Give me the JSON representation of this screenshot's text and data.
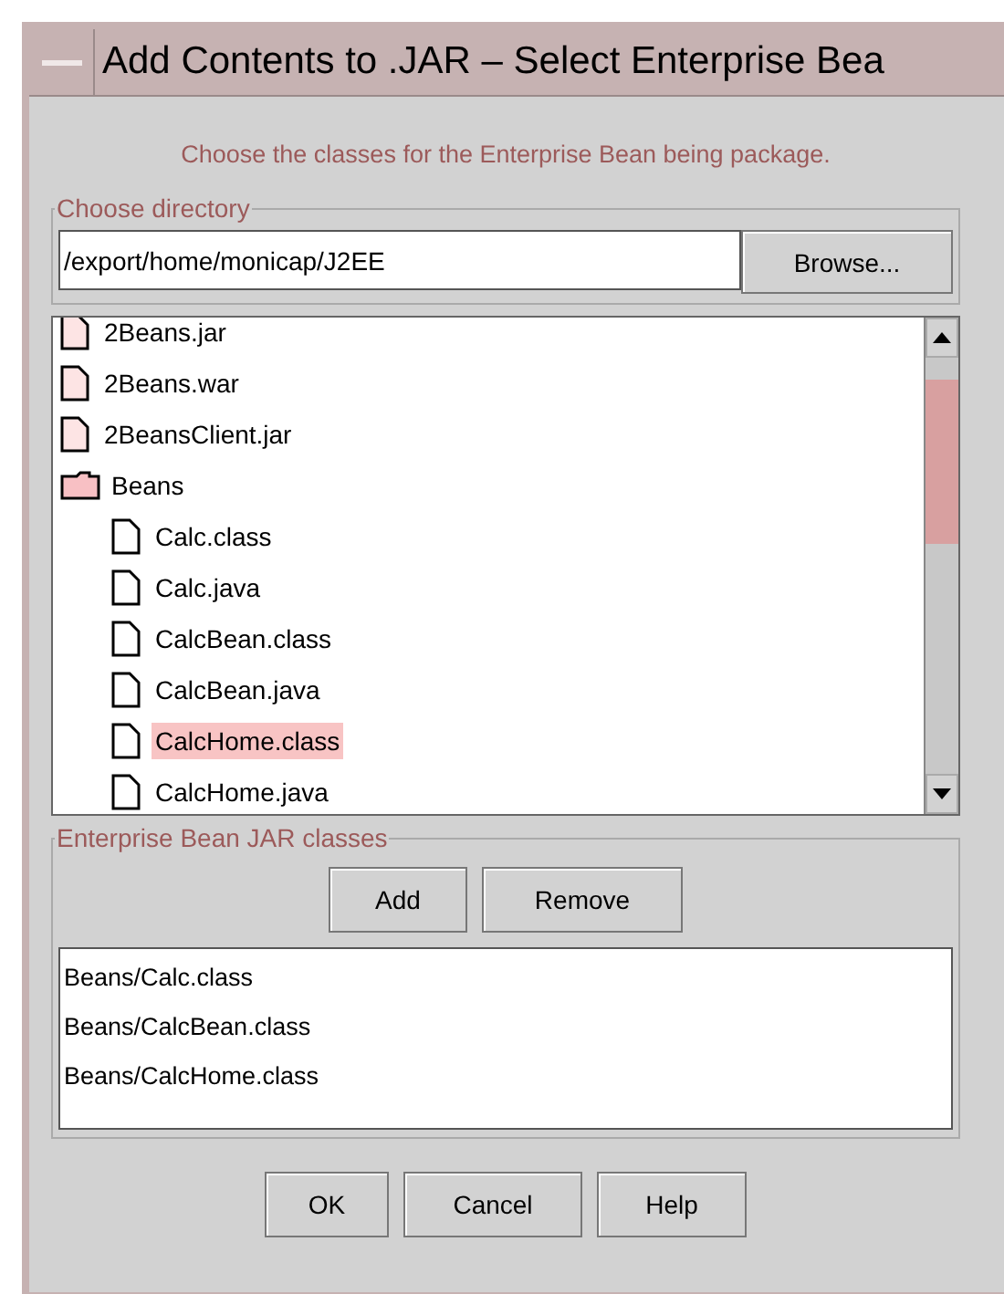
{
  "window": {
    "title": "Add Contents to .JAR – Select Enterprise Bea"
  },
  "instruction": "Choose the classes for the Enterprise Bean being package.",
  "directory": {
    "label": "Choose directory",
    "value": "/export/home/monicap/J2EE",
    "browse": "Browse..."
  },
  "tree": [
    {
      "name": "2Beans.jar",
      "kind": "file",
      "selected": false
    },
    {
      "name": "2Beans.war",
      "kind": "file",
      "selected": false
    },
    {
      "name": "2BeansClient.jar",
      "kind": "file",
      "selected": false
    },
    {
      "name": "Beans",
      "kind": "folder",
      "selected": false,
      "children": [
        {
          "name": "Calc.class",
          "kind": "file",
          "selected": false
        },
        {
          "name": "Calc.java",
          "kind": "file",
          "selected": false
        },
        {
          "name": "CalcBean.class",
          "kind": "file",
          "selected": false
        },
        {
          "name": "CalcBean.java",
          "kind": "file",
          "selected": false
        },
        {
          "name": "CalcHome.class",
          "kind": "file",
          "selected": true
        },
        {
          "name": "CalcHome.java",
          "kind": "file",
          "selected": false
        }
      ]
    }
  ],
  "jar_classes": {
    "label": "Enterprise Bean JAR classes",
    "buttons": [
      "Add",
      "Remove"
    ],
    "items": [
      "Beans/Calc.class",
      "Beans/CalcBean.class",
      "Beans/CalcHome.class"
    ]
  },
  "buttons": [
    "OK",
    "Cancel",
    "Help"
  ]
}
